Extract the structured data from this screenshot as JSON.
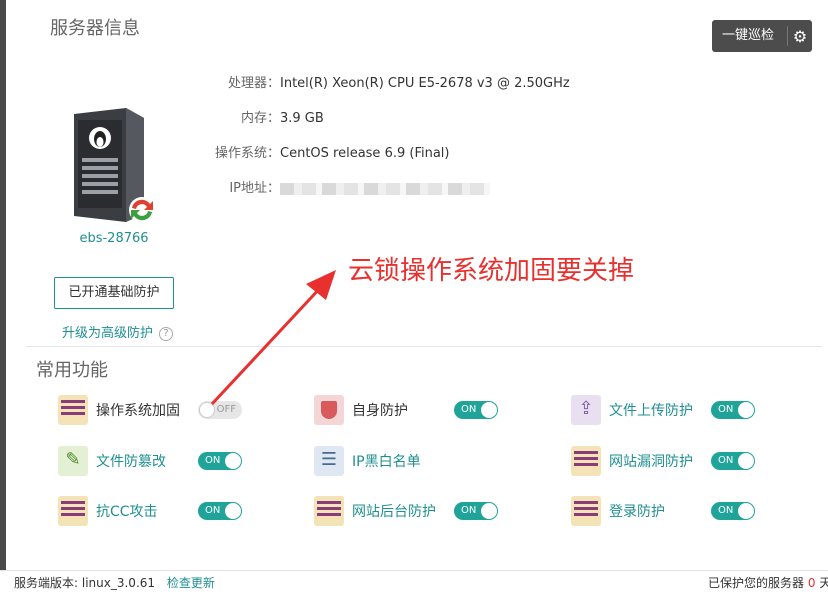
{
  "server_info": {
    "title": "服务器信息",
    "inspect_button": "一键巡检",
    "server_name": "ebs-28766",
    "cpu_label": "处理器：",
    "cpu_value": "Intel(R) Xeon(R) CPU E5-2678 v3 @ 2.50GHz",
    "mem_label": "内存：",
    "mem_value": "3.9 GB",
    "os_label": "操作系统：",
    "os_value": "CentOS release 6.9 (Final)",
    "ip_label": "IP地址：",
    "protect_button": "已开通基础防护",
    "upgrade_link": "升级为高级防护",
    "help_icon": "?"
  },
  "functions": {
    "title": "常用功能",
    "items": [
      {
        "label": "操作系统加固",
        "icon": "firewall-icon",
        "toggle": "OFF"
      },
      {
        "label": "自身防护",
        "icon": "shield-icon",
        "toggle": "ON"
      },
      {
        "label": "文件上传防护",
        "icon": "upload-icon",
        "toggle": "ON"
      },
      {
        "label": "文件防篡改",
        "icon": "document-edit-icon",
        "toggle": "ON"
      },
      {
        "label": "IP黑白名单",
        "icon": "list-icon",
        "toggle": null
      },
      {
        "label": "网站漏洞防护",
        "icon": "firewall-icon",
        "toggle": "ON"
      },
      {
        "label": "抗CC攻击",
        "icon": "firewall-icon",
        "toggle": "ON"
      },
      {
        "label": "网站后台防护",
        "icon": "firewall-icon",
        "toggle": "ON"
      },
      {
        "label": "登录防护",
        "icon": "firewall-icon",
        "toggle": "ON"
      }
    ]
  },
  "annotation": "云锁操作系统加固要关掉",
  "footer": {
    "version_label": "服务端版本:",
    "version": "linux_3.0.61",
    "check_update": "检查更新",
    "protected_text": "已保护您的服务器",
    "protected_count": "0",
    "protected_suffix": "天"
  },
  "colors": {
    "accent": "#1f8f90",
    "toggle_on": "#20a49a",
    "annotation": "#e8312f"
  }
}
